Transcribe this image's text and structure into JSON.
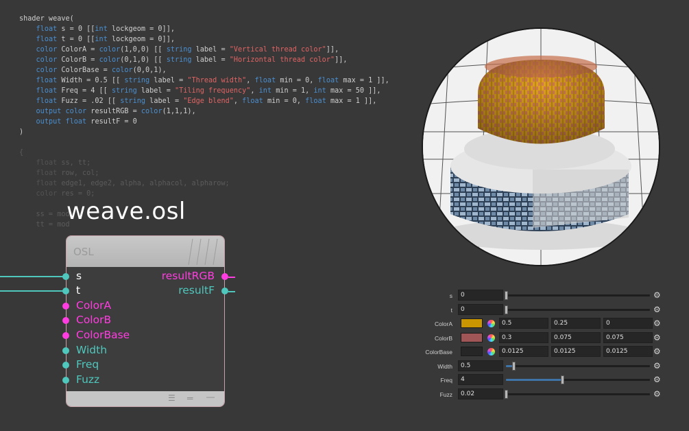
{
  "code_lines": [
    {
      "dim": false,
      "parts": [
        {
          "t": "shader weave("
        }
      ]
    },
    {
      "dim": false,
      "parts": [
        {
          "t": "    "
        },
        {
          "t": "float",
          "c": "kw"
        },
        {
          "t": " s = 0 [["
        },
        {
          "t": "int",
          "c": "kw"
        },
        {
          "t": " lockgeom = 0]],"
        }
      ]
    },
    {
      "dim": false,
      "parts": [
        {
          "t": "    "
        },
        {
          "t": "float",
          "c": "kw"
        },
        {
          "t": " t = 0 [["
        },
        {
          "t": "int",
          "c": "kw"
        },
        {
          "t": " lockgeom = 0]],"
        }
      ]
    },
    {
      "dim": false,
      "parts": [
        {
          "t": "    "
        },
        {
          "t": "color",
          "c": "kw"
        },
        {
          "t": " ColorA = "
        },
        {
          "t": "color",
          "c": "kw"
        },
        {
          "t": "(1,0,0) [[ "
        },
        {
          "t": "string",
          "c": "kw"
        },
        {
          "t": " label = "
        },
        {
          "t": "\"Vertical thread color\"",
          "c": "st"
        },
        {
          "t": "]],"
        }
      ]
    },
    {
      "dim": false,
      "parts": [
        {
          "t": "    "
        },
        {
          "t": "color",
          "c": "kw"
        },
        {
          "t": " ColorB = "
        },
        {
          "t": "color",
          "c": "kw"
        },
        {
          "t": "(0,1,0) [[ "
        },
        {
          "t": "string",
          "c": "kw"
        },
        {
          "t": " label = "
        },
        {
          "t": "\"Horizontal thread color\"",
          "c": "st"
        },
        {
          "t": "]],"
        }
      ]
    },
    {
      "dim": false,
      "parts": [
        {
          "t": "    "
        },
        {
          "t": "color",
          "c": "kw"
        },
        {
          "t": " ColorBase = "
        },
        {
          "t": "color",
          "c": "kw"
        },
        {
          "t": "(0,0,1),"
        }
      ]
    },
    {
      "dim": false,
      "parts": [
        {
          "t": "    "
        },
        {
          "t": "float",
          "c": "kw"
        },
        {
          "t": " Width = 0.5 [[ "
        },
        {
          "t": "string",
          "c": "kw"
        },
        {
          "t": " label = "
        },
        {
          "t": "\"Thread width\"",
          "c": "st"
        },
        {
          "t": ", "
        },
        {
          "t": "float",
          "c": "kw"
        },
        {
          "t": " min = 0, "
        },
        {
          "t": "float",
          "c": "kw"
        },
        {
          "t": " max = 1 ]],"
        }
      ]
    },
    {
      "dim": false,
      "parts": [
        {
          "t": "    "
        },
        {
          "t": "float",
          "c": "kw"
        },
        {
          "t": " Freq = 4 [[ "
        },
        {
          "t": "string",
          "c": "kw"
        },
        {
          "t": " label = "
        },
        {
          "t": "\"Tiling frequency\"",
          "c": "st"
        },
        {
          "t": ", "
        },
        {
          "t": "int",
          "c": "kw"
        },
        {
          "t": " min = 1, "
        },
        {
          "t": "int",
          "c": "kw"
        },
        {
          "t": " max = 50 ]],"
        }
      ]
    },
    {
      "dim": false,
      "parts": [
        {
          "t": "    "
        },
        {
          "t": "float",
          "c": "kw"
        },
        {
          "t": " Fuzz = .02 [[ "
        },
        {
          "t": "string",
          "c": "kw"
        },
        {
          "t": " label = "
        },
        {
          "t": "\"Edge blend\"",
          "c": "st"
        },
        {
          "t": ", "
        },
        {
          "t": "float",
          "c": "kw"
        },
        {
          "t": " min = 0, "
        },
        {
          "t": "float",
          "c": "kw"
        },
        {
          "t": " max = 1 ]],"
        }
      ]
    },
    {
      "dim": false,
      "parts": [
        {
          "t": "    "
        },
        {
          "t": "output",
          "c": "kw"
        },
        {
          "t": " "
        },
        {
          "t": "color",
          "c": "kw"
        },
        {
          "t": " resultRGB = "
        },
        {
          "t": "color",
          "c": "kw"
        },
        {
          "t": "(1,1,1),"
        }
      ]
    },
    {
      "dim": false,
      "parts": [
        {
          "t": "    "
        },
        {
          "t": "output",
          "c": "kw"
        },
        {
          "t": " "
        },
        {
          "t": "float",
          "c": "kw"
        },
        {
          "t": " resultF = 0"
        }
      ]
    },
    {
      "dim": false,
      "parts": [
        {
          "t": ")"
        }
      ]
    },
    {
      "dim": false,
      "parts": [
        {
          "t": ""
        }
      ]
    },
    {
      "dim": true,
      "parts": [
        {
          "t": "{"
        }
      ]
    },
    {
      "dim": true,
      "parts": [
        {
          "t": "    "
        },
        {
          "t": "float",
          "c": "kw"
        },
        {
          "t": " ss, tt;"
        }
      ]
    },
    {
      "dim": true,
      "parts": [
        {
          "t": "    "
        },
        {
          "t": "float",
          "c": "kw"
        },
        {
          "t": " row, col;"
        }
      ]
    },
    {
      "dim": true,
      "parts": [
        {
          "t": "    "
        },
        {
          "t": "float",
          "c": "kw"
        },
        {
          "t": " edge1, edge2, alpha, alphacol, alpharow;"
        }
      ]
    },
    {
      "dim": true,
      "parts": [
        {
          "t": "    "
        },
        {
          "t": "color",
          "c": "kw"
        },
        {
          "t": " res = 0;"
        }
      ]
    },
    {
      "dim": true,
      "parts": [
        {
          "t": ""
        }
      ]
    },
    {
      "dim": true,
      "parts": [
        {
          "t": "    ss = mod"
        }
      ]
    },
    {
      "dim": true,
      "parts": [
        {
          "t": "    tt = mod"
        }
      ]
    }
  ],
  "node": {
    "title": "weave.osl",
    "header_logo": "OSL",
    "inputs": [
      {
        "label": "s",
        "color": "#ffffff",
        "dot": "#4fc7bd",
        "wired": true
      },
      {
        "label": "t",
        "color": "#ffffff",
        "dot": "#4fc7bd",
        "wired": true
      },
      {
        "label": "ColorA",
        "color": "#ff3de0",
        "dot": "#ff3de0",
        "wired": false
      },
      {
        "label": "ColorB",
        "color": "#ff3de0",
        "dot": "#ff3de0",
        "wired": false
      },
      {
        "label": "ColorBase",
        "color": "#ff3de0",
        "dot": "#ff3de0",
        "wired": false
      },
      {
        "label": "Width",
        "color": "#4fc7bd",
        "dot": "#4fc7bd",
        "wired": false
      },
      {
        "label": "Freq",
        "color": "#4fc7bd",
        "dot": "#4fc7bd",
        "wired": false
      },
      {
        "label": "Fuzz",
        "color": "#4fc7bd",
        "dot": "#4fc7bd",
        "wired": false
      }
    ],
    "outputs": [
      {
        "label": "resultRGB",
        "color": "#ff3de0"
      },
      {
        "label": "resultF",
        "color": "#4fc7bd"
      }
    ]
  },
  "params": [
    {
      "label": "s",
      "type": "float",
      "value": "0",
      "slider": 0
    },
    {
      "label": "t",
      "type": "float",
      "value": "0",
      "slider": 0
    },
    {
      "label": "ColorA",
      "type": "color",
      "swatch": "#c99500",
      "values": [
        "0.5",
        "0.25",
        "0"
      ]
    },
    {
      "label": "ColorB",
      "type": "color",
      "swatch": "#a05657",
      "values": [
        "0.3",
        "0.075",
        "0.075"
      ]
    },
    {
      "label": "ColorBase",
      "type": "color",
      "swatch": "#262626",
      "values": [
        "0.0125",
        "0.0125",
        "0.0125"
      ]
    },
    {
      "label": "Width",
      "type": "float",
      "value": "0.5",
      "slider": 0.05
    },
    {
      "label": "Freq",
      "type": "float",
      "value": "4",
      "slider": 0.39
    },
    {
      "label": "Fuzz",
      "type": "float",
      "value": "0.02",
      "slider": 0.0
    }
  ],
  "colors": {
    "accent_magenta": "#ff3de0",
    "accent_teal": "#4fc7bd",
    "slider_fill": "#3f74a8"
  }
}
